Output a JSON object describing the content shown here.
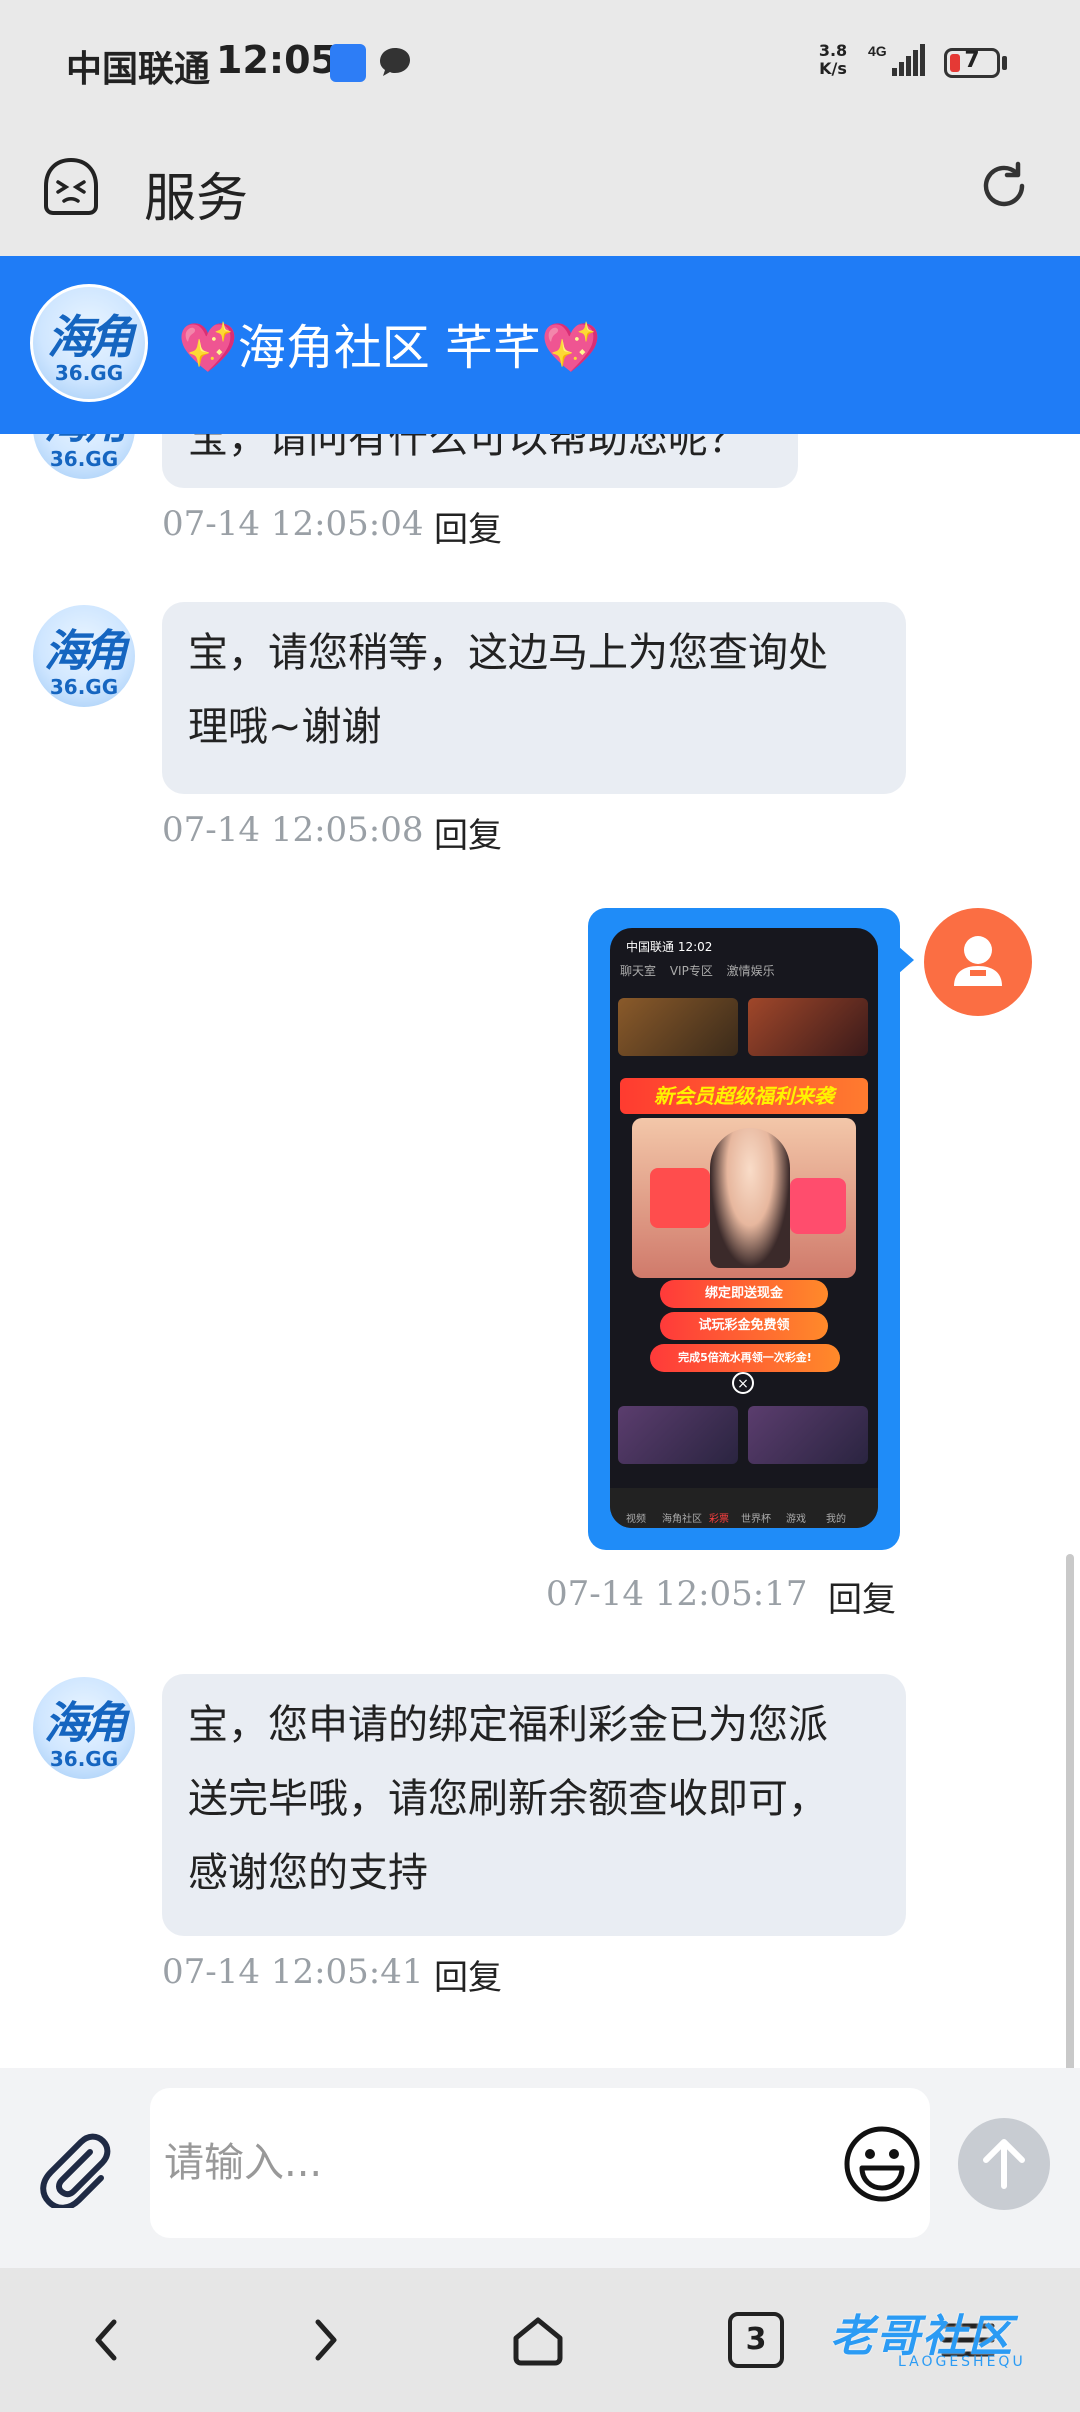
{
  "status_bar": {
    "carrier": "中国联通",
    "time": "12:05",
    "app_badge": "鱼泡直聘",
    "net_speed_value": "3.8",
    "net_speed_unit": "K/s",
    "network": "4G",
    "battery": "7"
  },
  "app_bar": {
    "title": "服务"
  },
  "service_header": {
    "logo_text": "海角",
    "logo_sub": "36.GG",
    "title": "💖海角社区 芊芊💖"
  },
  "messages": [
    {
      "from": "agent",
      "text": "宝，请问有什么可以帮助您呢？",
      "time": "07-14 12:05:04",
      "reply": "回复"
    },
    {
      "from": "agent",
      "text_line1": "宝，请您稍等，这边马上为您查询处",
      "text_line2": "理哦~谢谢",
      "time": "07-14 12:05:08",
      "reply": "回复"
    },
    {
      "from": "user",
      "type": "image",
      "time": "07-14 12:05:17",
      "reply": "回复",
      "screenshot": {
        "status": "中国联通 12:02",
        "tabs": [
          "聊天室",
          "VIP专区",
          "激情娱乐"
        ],
        "banner": "新会员超级福利来袭",
        "buttons": [
          "绑定即送现金",
          "试玩彩金免费领",
          "完成5倍流水再领一次彩金!"
        ],
        "nav": [
          "视频",
          "海角社区",
          "彩票",
          "世界杯",
          "游戏",
          "我的"
        ]
      }
    },
    {
      "from": "agent",
      "text_line1": "宝，您申请的绑定福利彩金已为您派",
      "text_line2": "送完毕哦，请您刷新余额查收即可，",
      "text_line3": "感谢您的支持",
      "time": "07-14 12:05:41",
      "reply": "回复"
    }
  ],
  "input_bar": {
    "placeholder": "请输入..."
  },
  "nav_bar": {
    "tab_count": "3",
    "watermark": "老哥社区",
    "watermark_sub": "LAOGESHEQU"
  },
  "colors": {
    "brand_blue": "#1f7cf6",
    "user_avatar": "#fb6e43",
    "bubble_bg": "#e9edf3"
  }
}
